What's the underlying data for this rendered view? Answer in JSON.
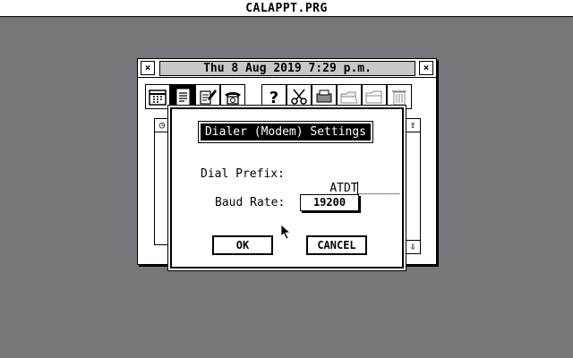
{
  "top_bar": {
    "title": "CALAPPT.PRG"
  },
  "window": {
    "title": "Thu 8 Aug 2019  7:29 p.m.",
    "close_glyph": "×",
    "fuller_glyph": "×",
    "toolbar": [
      "calendar-icon",
      "notepad-icon",
      "pencil-icon",
      "telephone-icon",
      "help-icon",
      "scissors-icon",
      "printer-icon",
      "folder-open-icon",
      "folder-icon",
      "trash-icon"
    ],
    "scroll_up": "⇧",
    "scroll_down": "⇩",
    "clock_glyph": "◷"
  },
  "dialog": {
    "title": "Dialer (Modem) Settings",
    "dial_prefix_label": "Dial Prefix:",
    "dial_prefix_value": "ATDT",
    "dial_prefix_blank": "______",
    "baud_rate_label": "Baud Rate:",
    "baud_rate_value": "19200",
    "ok_label": "OK",
    "cancel_label": "CANCEL"
  }
}
